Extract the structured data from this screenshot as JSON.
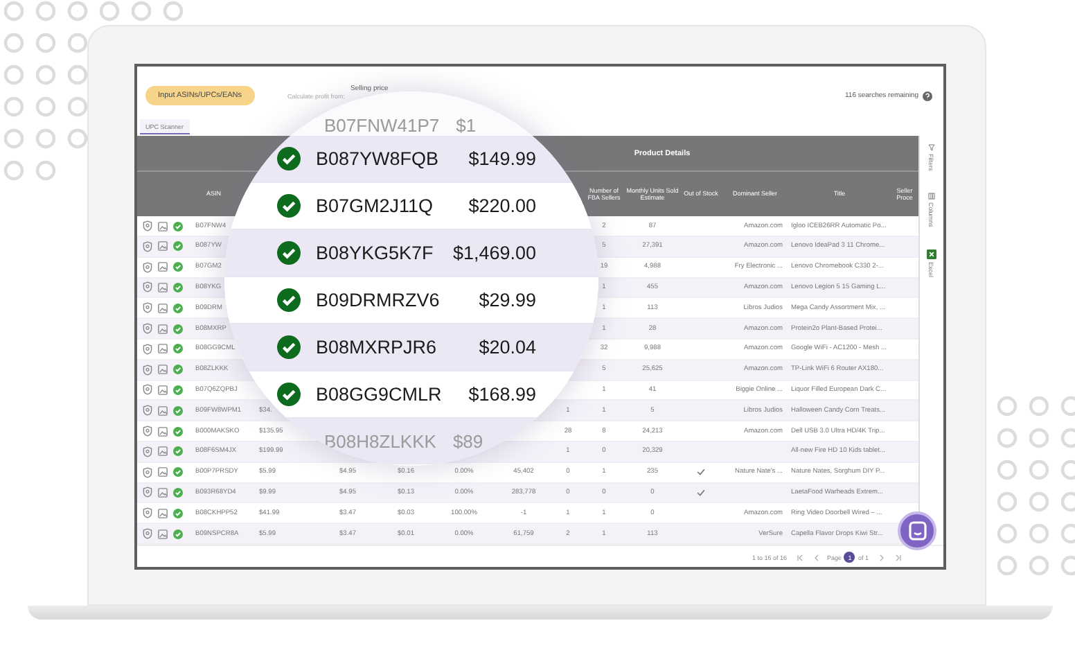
{
  "toolbar": {
    "input_button": "Input ASINs/UPCs/EANs",
    "calc_label": "Calculate profit from:",
    "price_basis": "Selling price",
    "searches": "116 searches remaining"
  },
  "tabs": [
    {
      "label": "UPC Scanner",
      "selected": true
    }
  ],
  "table": {
    "group_header": "Product Details",
    "headers": {
      "asin": "ASIN",
      "fba_sellers": "Number of FBA Sellers",
      "monthly_units": "Monthly Units Sold Estimate",
      "out_of_stock": "Out of Stock",
      "dominant_seller": "Dominant Seller",
      "title": "Title",
      "seller_proceeds": "Seller Proce"
    },
    "rows": [
      {
        "asin": "B07FNW4",
        "fba_sellers": "2",
        "monthly_units": "87",
        "out_of_stock": false,
        "dominant_seller": "Amazon.com",
        "title": "Igloo ICEB26RR Automatic Po..."
      },
      {
        "asin": "B087YW",
        "fba_sellers": "5",
        "monthly_units": "27,391",
        "out_of_stock": false,
        "dominant_seller": "Amazon.com",
        "title": "Lenovo IdeaPad 3 11 Chrome..."
      },
      {
        "asin": "B07GM2",
        "fba_sellers": "19",
        "monthly_units": "4,988",
        "out_of_stock": false,
        "dominant_seller": "Fry Electronic ...",
        "title": "Lenovo Chromebook C330 2-..."
      },
      {
        "asin": "B08YKG",
        "fba_sellers": "1",
        "monthly_units": "455",
        "out_of_stock": false,
        "dominant_seller": "Amazon.com",
        "title": "Lenovo Legion 5 15 Gaming L..."
      },
      {
        "asin": "B09DRM",
        "fba_sellers": "1",
        "monthly_units": "113",
        "out_of_stock": false,
        "dominant_seller": "Libros Judios",
        "title": "Mega Candy Assortment Mix, ..."
      },
      {
        "asin": "B08MXRP",
        "fba_sellers": "1",
        "monthly_units": "28",
        "out_of_stock": false,
        "dominant_seller": "Amazon.com",
        "title": "Protein2o Plant-Based Protei..."
      },
      {
        "asin": "B08GG9CML",
        "fba_sellers": "32",
        "monthly_units": "9,988",
        "out_of_stock": false,
        "dominant_seller": "Amazon.com",
        "title": "Google WiFi - AC1200 - Mesh ..."
      },
      {
        "asin": "B08ZLKKK",
        "fba_sellers": "5",
        "monthly_units": "25,625",
        "out_of_stock": false,
        "dominant_seller": "Amazon.com",
        "title": "TP-Link WiFi 6 Router AX180..."
      },
      {
        "asin": "B07Q6ZQPBJ",
        "fba_sellers": "1",
        "monthly_units": "41",
        "out_of_stock": false,
        "dominant_seller": "Biggie Online ...",
        "title": "Liquor Filled European Dark C..."
      },
      {
        "asin": "B09FW8WPM1",
        "price": "$34.",
        "column_7": "1",
        "fba_sellers": "1",
        "monthly_units": "5",
        "out_of_stock": false,
        "dominant_seller": "Libros Judios",
        "title": "Halloween Candy Corn Treats..."
      },
      {
        "asin": "B000MAKSKO",
        "price": "$135.95",
        "column_7": "28",
        "fba_sellers": "8",
        "monthly_units": "24,213",
        "out_of_stock": false,
        "dominant_seller": "Amazon.com",
        "title": "Dell USB 3.0 Ultra HD/4K Trip..."
      },
      {
        "asin": "B08F6SM4JX",
        "price": "$199.99",
        "column_7": "1",
        "fba_sellers": "0",
        "monthly_units": "20,329",
        "out_of_stock": false,
        "title": "All-new Fire HD 10 Kids tablet..."
      },
      {
        "asin": "B00P7PRSDY",
        "price": "$5.99",
        "column_3": "$4.95",
        "column_4": "$0.16",
        "column_5": "0.00%",
        "column_6": "45,402",
        "column_7": "0",
        "fba_sellers": "1",
        "monthly_units": "235",
        "out_of_stock": true,
        "dominant_seller": "Nature Nate's ...",
        "title": "Nature Nates, Sorghum DIY P..."
      },
      {
        "asin": "B093R68YD4",
        "price": "$9.99",
        "column_3": "$4.95",
        "column_4": "$0.13",
        "column_5": "0.00%",
        "column_6": "283,778",
        "column_7": "0",
        "fba_sellers": "0",
        "monthly_units": "0",
        "out_of_stock": true,
        "title": "LaetaFood Warheads Extrem..."
      },
      {
        "asin": "B08CKHPP52",
        "price": "$41.99",
        "column_3": "$3.47",
        "column_4": "$0.03",
        "column_5": "100.00%",
        "column_6": "-1",
        "column_7": "1",
        "fba_sellers": "1",
        "monthly_units": "0",
        "out_of_stock": false,
        "dominant_seller": "Amazon.com",
        "title": "Ring Video Doorbell Wired – ..."
      },
      {
        "asin": "B09NSPCR8A",
        "price": "$5.99",
        "column_3": "$3.47",
        "column_4": "$0.01",
        "column_5": "0.00%",
        "column_6": "61,759",
        "column_7": "2",
        "fba_sellers": "1",
        "monthly_units": "113",
        "out_of_stock": false,
        "dominant_seller": "VerSure",
        "title": "Capella Flavor Drops Kiwi Str..."
      }
    ]
  },
  "side_tools": [
    {
      "kind": "filters",
      "label": "Filters"
    },
    {
      "kind": "columns",
      "label": "Columns"
    },
    {
      "kind": "excel",
      "label": "Excel"
    }
  ],
  "pagination": {
    "range": "1 to 16 of 16",
    "page_label": "Page",
    "pages": [
      {
        "label": "1",
        "selected": true
      }
    ],
    "of_label": "of 1"
  },
  "magnifier": {
    "rows": [
      {
        "kind": "edge",
        "asin": "B07FNW41P7",
        "price": "$1"
      },
      {
        "kind": "full",
        "asin": "B087YW8FQB",
        "price": "$149.99"
      },
      {
        "kind": "full",
        "asin": "B07GM2J11Q",
        "price": "$220.00"
      },
      {
        "kind": "full",
        "asin": "B08YKG5K7F",
        "price": "$1,469.00"
      },
      {
        "kind": "full",
        "asin": "B09DRMRZV6",
        "price": "$29.99"
      },
      {
        "kind": "full",
        "asin": "B08MXRPJR6",
        "price": "$20.04"
      },
      {
        "kind": "full",
        "asin": "B08GG9CMLR",
        "price": "$168.99"
      },
      {
        "kind": "edge",
        "asin": "B08H8ZLKKK",
        "price": "$89"
      }
    ]
  }
}
